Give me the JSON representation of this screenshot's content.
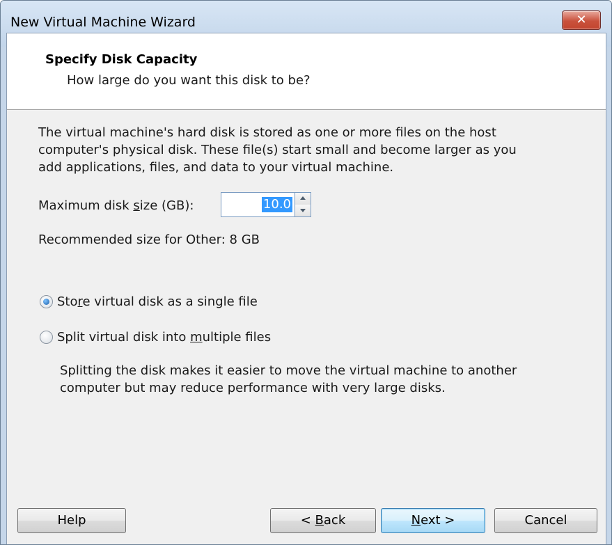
{
  "window": {
    "title": "New Virtual Machine Wizard",
    "close_glyph": "✕"
  },
  "header": {
    "title": "Specify Disk Capacity",
    "subtitle": "How large do you want this disk to be?"
  },
  "body": {
    "description": [
      "The virtual machine's hard disk is stored as one or more files on the host",
      "computer's physical disk. These file(s) start small and become larger as you",
      "add applications, files, and data to your virtual machine."
    ],
    "disk_size": {
      "label_pre": "Maximum disk ",
      "label_u": "s",
      "label_post": "ize (GB):",
      "value": "10.0"
    },
    "recommended": "Recommended size for Other: 8 GB",
    "options": [
      {
        "pre": "Sto",
        "u": "r",
        "post": "e virtual disk as a single file",
        "selected": true
      },
      {
        "pre": "Split virtual disk into ",
        "u": "m",
        "post": "ultiple files",
        "selected": false
      }
    ],
    "note": [
      "Splitting the disk makes it easier to move the virtual machine to another",
      "computer but may reduce performance with very large disks."
    ]
  },
  "buttons": {
    "help": "Help",
    "back": {
      "pre": "< ",
      "u": "B",
      "post": "ack"
    },
    "next": {
      "pre": "",
      "u": "N",
      "post": "ext >"
    },
    "cancel": "Cancel"
  },
  "colors": {
    "selection": "#3399ff",
    "close_button": "#c9513c",
    "default_button_border": "#3c7fb1"
  },
  "icons": [
    "close-icon",
    "spin-up-icon",
    "spin-down-icon"
  ]
}
